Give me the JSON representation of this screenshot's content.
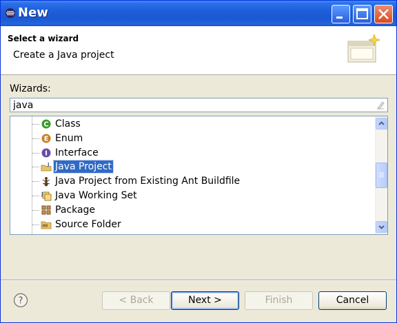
{
  "window": {
    "title": "New"
  },
  "header": {
    "title": "Select a wizard",
    "description": "Create a Java project"
  },
  "wizards": {
    "label": "Wizards:",
    "filter_value": "java",
    "items": [
      {
        "label": "Class",
        "icon": "java-class-icon"
      },
      {
        "label": "Enum",
        "icon": "java-enum-icon"
      },
      {
        "label": "Interface",
        "icon": "java-interface-icon"
      },
      {
        "label": "Java Project",
        "icon": "java-project-icon",
        "selected": true
      },
      {
        "label": "Java Project from Existing Ant Buildfile",
        "icon": "ant-buildfile-icon"
      },
      {
        "label": "Java Working Set",
        "icon": "working-set-icon"
      },
      {
        "label": "Package",
        "icon": "package-icon"
      },
      {
        "label": "Source Folder",
        "icon": "source-folder-icon"
      }
    ]
  },
  "buttons": {
    "back": "< Back",
    "next": "Next >",
    "finish": "Finish",
    "cancel": "Cancel"
  },
  "colors": {
    "selection": "#316ac5",
    "titlebar": "#1f5fd9",
    "dialog_bg": "#ece9d8"
  }
}
